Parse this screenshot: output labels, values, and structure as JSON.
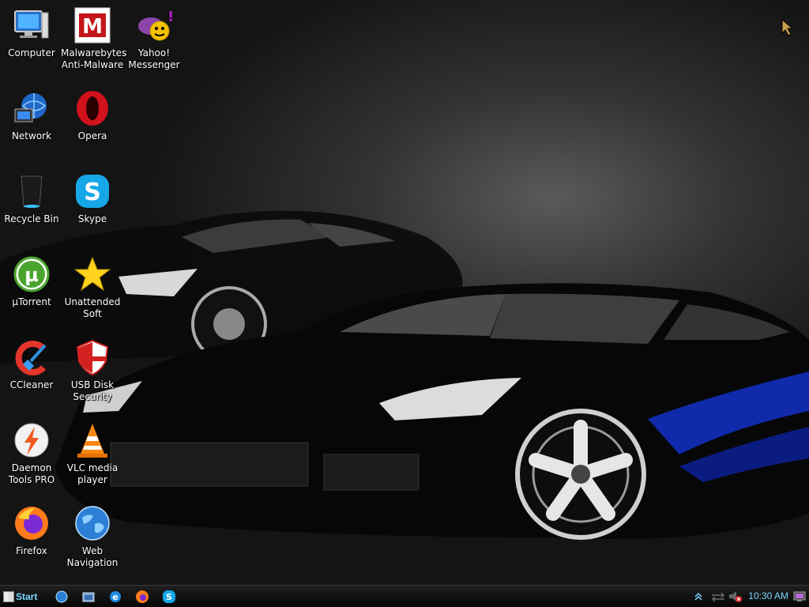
{
  "desktop": {
    "icons": [
      {
        "label": "Computer",
        "icon": "computer-icon"
      },
      {
        "label": "Malwarebytes\nAnti-Malware",
        "icon": "malwarebytes-icon"
      },
      {
        "label": "Yahoo!\nMessenger",
        "icon": "yahoo-messenger-icon"
      },
      {
        "label": "Network",
        "icon": "network-icon"
      },
      {
        "label": "Opera",
        "icon": "opera-icon"
      },
      {
        "label": "Recycle Bin",
        "icon": "recycle-bin-icon"
      },
      {
        "label": "Skype",
        "icon": "skype-icon"
      },
      {
        "label": "µTorrent",
        "icon": "utorrent-icon"
      },
      {
        "label": "Unattended\nSoft",
        "icon": "star-icon"
      },
      {
        "label": "CCleaner",
        "icon": "ccleaner-icon"
      },
      {
        "label": "USB Disk\nSecurity",
        "icon": "shield-icon"
      },
      {
        "label": "Daemon\nTools PRO",
        "icon": "daemon-tools-icon"
      },
      {
        "label": "VLC media\nplayer",
        "icon": "vlc-icon"
      },
      {
        "label": "Firefox",
        "icon": "firefox-icon"
      },
      {
        "label": "Web\nNavigation",
        "icon": "globe-icon"
      }
    ]
  },
  "taskbar": {
    "start_label": "Start",
    "quick_launch": [
      "globe-icon",
      "folder-icon",
      "ie-icon",
      "firefox-icon",
      "skype-icon"
    ],
    "tray": {
      "icons": [
        "chevron-up-icon",
        "network-arrows-icon",
        "volume-muted-icon",
        "monitor-icon"
      ],
      "clock": "10:30 AM"
    }
  },
  "colors": {
    "taskbar_text": "#7cd6ff",
    "desktop_label": "#ffffff"
  }
}
